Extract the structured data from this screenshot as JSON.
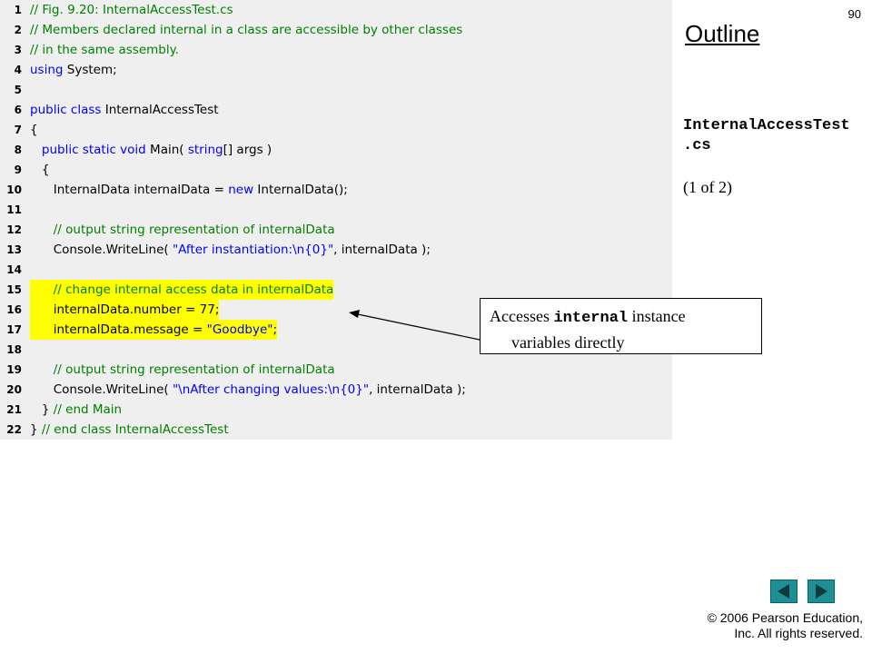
{
  "slide": {
    "page_number": "90",
    "outline_label": "Outline",
    "file_name_line1": "InternalAccessTest",
    "file_name_line2": ".cs",
    "page_of": "(1 of 2)"
  },
  "code_lines": [
    {
      "num": "1",
      "parts": [
        {
          "t": "// Fig. 9.20: InternalAccessTest.cs",
          "c": "cm"
        }
      ]
    },
    {
      "num": "2",
      "parts": [
        {
          "t": "// Members declared internal in a class are accessible by other classes",
          "c": "cm"
        }
      ]
    },
    {
      "num": "3",
      "parts": [
        {
          "t": "// in the same assembly.",
          "c": "cm"
        }
      ]
    },
    {
      "num": "4",
      "parts": [
        {
          "t": "using",
          "c": "kw"
        },
        {
          "t": " System;",
          "c": ""
        }
      ]
    },
    {
      "num": "5",
      "parts": []
    },
    {
      "num": "6",
      "parts": [
        {
          "t": "public",
          "c": "kw"
        },
        {
          "t": " ",
          "c": ""
        },
        {
          "t": "class",
          "c": "kw"
        },
        {
          "t": " InternalAccessTest",
          "c": ""
        }
      ]
    },
    {
      "num": "7",
      "parts": [
        {
          "t": "{",
          "c": ""
        }
      ]
    },
    {
      "num": "8",
      "parts": [
        {
          "t": "   ",
          "c": ""
        },
        {
          "t": "public",
          "c": "kw"
        },
        {
          "t": " ",
          "c": ""
        },
        {
          "t": "static",
          "c": "kw"
        },
        {
          "t": " ",
          "c": ""
        },
        {
          "t": "void",
          "c": "kw"
        },
        {
          "t": " Main( ",
          "c": ""
        },
        {
          "t": "string",
          "c": "kw"
        },
        {
          "t": "[] args )",
          "c": ""
        }
      ]
    },
    {
      "num": "9",
      "parts": [
        {
          "t": "   {",
          "c": ""
        }
      ]
    },
    {
      "num": "10",
      "parts": [
        {
          "t": "      InternalData internalData = ",
          "c": ""
        },
        {
          "t": "new",
          "c": "kw"
        },
        {
          "t": " InternalData();",
          "c": ""
        }
      ]
    },
    {
      "num": "11",
      "parts": []
    },
    {
      "num": "12",
      "parts": [
        {
          "t": "      ",
          "c": ""
        },
        {
          "t": "// output string representation of internalData",
          "c": "cm"
        }
      ]
    },
    {
      "num": "13",
      "parts": [
        {
          "t": "      Console.WriteLine( ",
          "c": ""
        },
        {
          "t": "\"After instantiation:\\n{0}\"",
          "c": "str"
        },
        {
          "t": ", internalData );",
          "c": ""
        }
      ]
    },
    {
      "num": "14",
      "parts": []
    },
    {
      "num": "15",
      "hl": true,
      "parts": [
        {
          "t": "      ",
          "c": ""
        },
        {
          "t": "// change internal access data in internalData",
          "c": "cm"
        }
      ]
    },
    {
      "num": "16",
      "hl": true,
      "parts": [
        {
          "t": "      internalData.number = 77;",
          "c": ""
        }
      ]
    },
    {
      "num": "17",
      "hl": true,
      "parts": [
        {
          "t": "      internalData.message = ",
          "c": ""
        },
        {
          "t": "\"Goodbye\"",
          "c": "str"
        },
        {
          "t": ";",
          "c": ""
        }
      ]
    },
    {
      "num": "18",
      "parts": []
    },
    {
      "num": "19",
      "parts": [
        {
          "t": "      ",
          "c": ""
        },
        {
          "t": "// output string representation of internalData",
          "c": "cm"
        }
      ]
    },
    {
      "num": "20",
      "parts": [
        {
          "t": "      Console.WriteLine( ",
          "c": ""
        },
        {
          "t": "\"\\nAfter changing values:\\n{0}\"",
          "c": "str"
        },
        {
          "t": ", internalData );",
          "c": ""
        }
      ]
    },
    {
      "num": "21",
      "parts": [
        {
          "t": "   } ",
          "c": ""
        },
        {
          "t": "// end Main",
          "c": "cm"
        }
      ]
    },
    {
      "num": "22",
      "parts": [
        {
          "t": "} ",
          "c": ""
        },
        {
          "t": "// end class InternalAccessTest",
          "c": "cm"
        }
      ]
    }
  ],
  "callout": {
    "prefix": "Accesses ",
    "keyword": "internal",
    "suffix": " instance",
    "line2": "variables directly"
  },
  "nav": {
    "prev_icon": "triangle-left-icon",
    "next_icon": "triangle-right-icon"
  },
  "copyright": {
    "line1": "© 2006 Pearson Education,",
    "line2": "Inc.  All rights reserved."
  },
  "colors": {
    "keyword": "#0000ff",
    "comment": "#008000",
    "highlight": "#ffff00",
    "code_background": "#efefef",
    "nav_button": "#1f8f96"
  }
}
